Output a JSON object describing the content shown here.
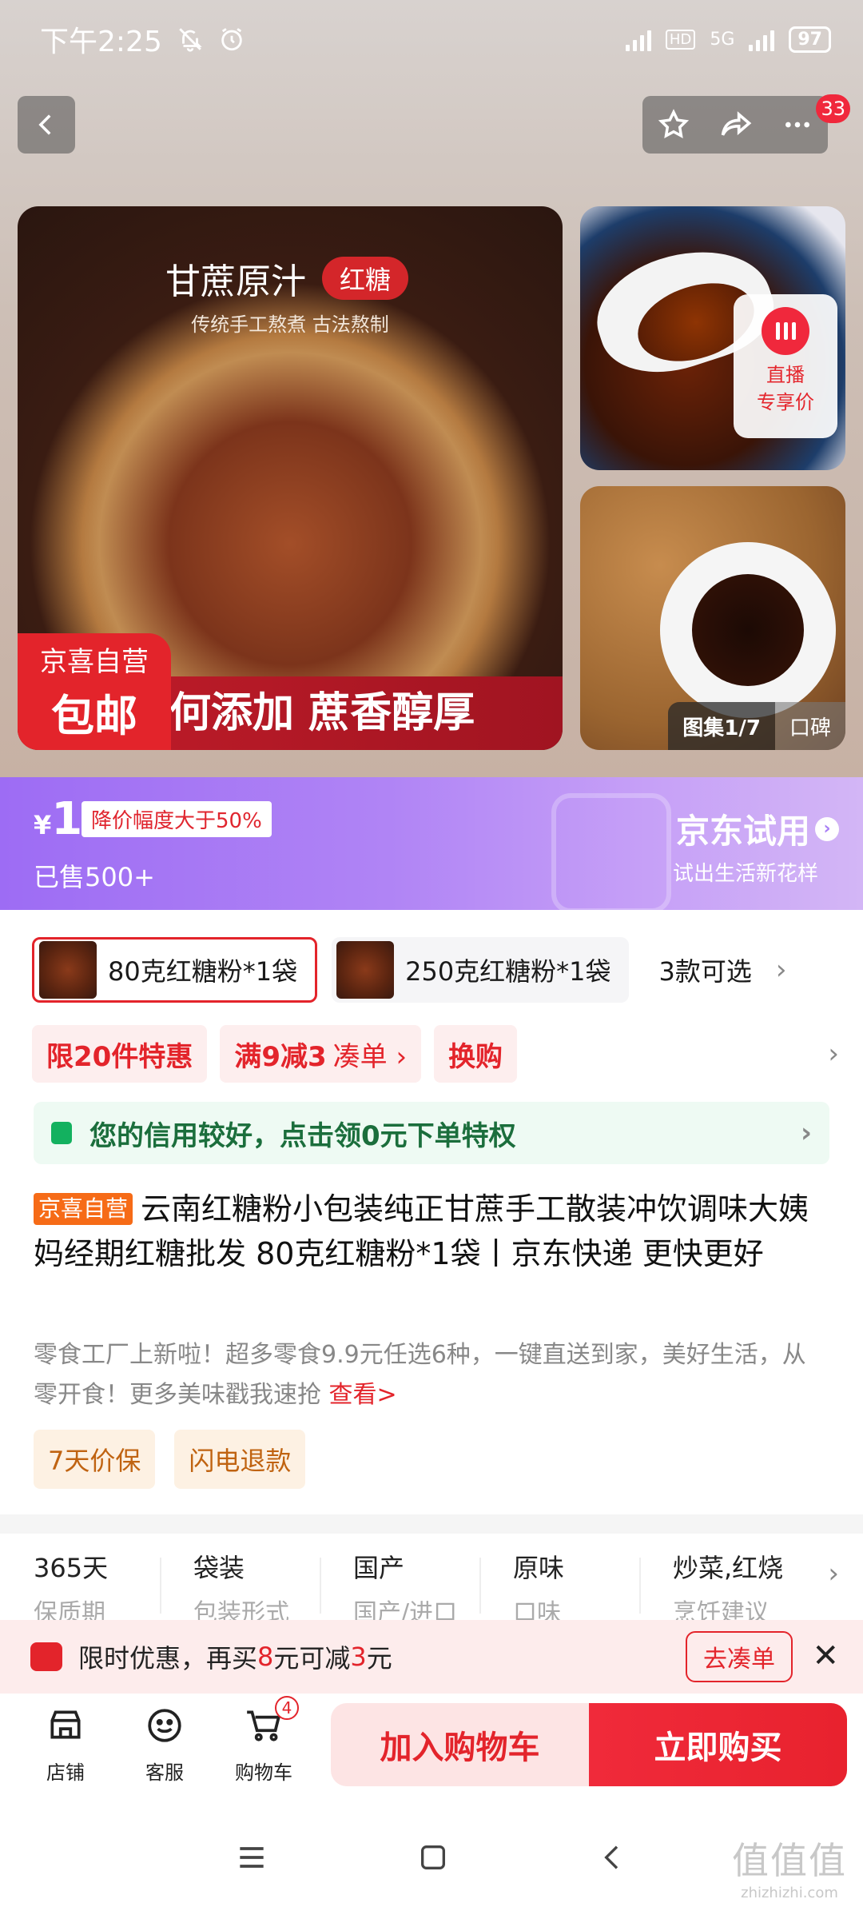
{
  "status_bar": {
    "time": "下午2:25",
    "battery": "97",
    "network": "5G",
    "hd": "HD"
  },
  "header": {
    "notification_count": "33"
  },
  "gallery": {
    "main_title": "甘蔗原汁",
    "main_tag": "红糖",
    "main_subtitle": "传统手工熬煮 古法熬制",
    "badge_line1": "京喜自营",
    "badge_line2": "包邮",
    "banner_text": "何添加 蔗香醇厚",
    "live_line1": "直播",
    "live_line2": "专享价",
    "gallery_label": "图集1/7",
    "review_label": "口碑"
  },
  "promo": {
    "currency": "¥",
    "price": "1",
    "drop_label": "降价幅度大于50%",
    "sold": "已售500+",
    "trial_title": "京东试用",
    "trial_sub": "试出生活新花样"
  },
  "variants": {
    "items": [
      {
        "label": "80克红糖粉*1袋"
      },
      {
        "label": "250克红糖粉*1袋"
      }
    ],
    "more": "3款可选"
  },
  "coupons": {
    "limit": "限20件特惠",
    "discount": "满9减3",
    "discount_action": "凑单 ›",
    "swap": "换购"
  },
  "credit": {
    "text": "您的信用较好，点击领0元下单特权"
  },
  "product": {
    "self_tag": "京喜自营",
    "title": "云南红糖粉小包装纯正甘蔗手工散装冲饮调味大姨妈经期红糖批发 80克红糖粉*1袋丨京东快递 更快更好",
    "desc": "零食工厂上新啦！超多零食9.9元任选6种，一键直送到家，美好生活，从零开食！更多美味戳我速抢",
    "desc_link": "查看>",
    "services": [
      "7天价保",
      "闪电退款"
    ]
  },
  "specs": [
    {
      "value": "365天",
      "key": "保质期"
    },
    {
      "value": "袋装",
      "key": "包装形式"
    },
    {
      "value": "国产",
      "key": "国产/进口"
    },
    {
      "value": "原味",
      "key": "口味"
    },
    {
      "value": "炒菜,红烧",
      "key": "烹饪建议"
    }
  ],
  "limited_offer": {
    "prefix": "限时优惠，再买",
    "amount1": "8",
    "mid": "元可减",
    "amount2": "3",
    "suffix": "元",
    "action": "去凑单"
  },
  "bottom_nav": {
    "store": "店铺",
    "service": "客服",
    "cart": "购物车",
    "cart_count": "4",
    "add_cart": "加入购物车",
    "buy_now": "立即购买"
  },
  "watermark": {
    "line1": "值值值",
    "line2": "zhizhizhi.com"
  }
}
